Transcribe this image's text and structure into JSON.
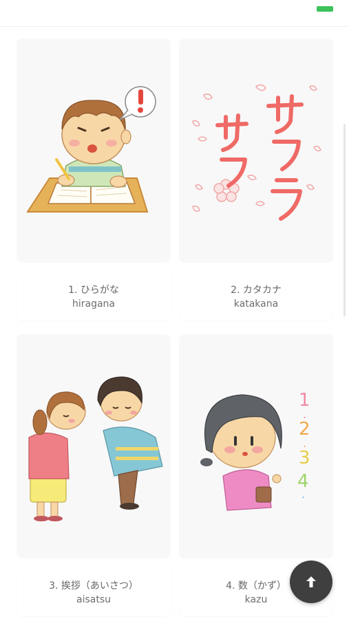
{
  "status": {
    "indicator_color": "#3cc15b"
  },
  "colors": {
    "card_bg": "#f8f8f8",
    "fab_bg": "#3f3f3f"
  },
  "cards": [
    {
      "title": "1. ひらがな",
      "romaji": "hiragana",
      "icon": "boy-studying-illustration"
    },
    {
      "title": "2. カタカナ",
      "romaji": "katakana",
      "icon": "sakura-katakana-illustration"
    },
    {
      "title": "3. 挨拶（あいさつ）",
      "romaji": "aisatsu",
      "icon": "bowing-people-illustration"
    },
    {
      "title": "4. 数（かず）",
      "romaji": "kazu",
      "icon": "girl-counting-illustration"
    }
  ],
  "scroll_top_button": {
    "icon": "arrow-up-icon"
  }
}
